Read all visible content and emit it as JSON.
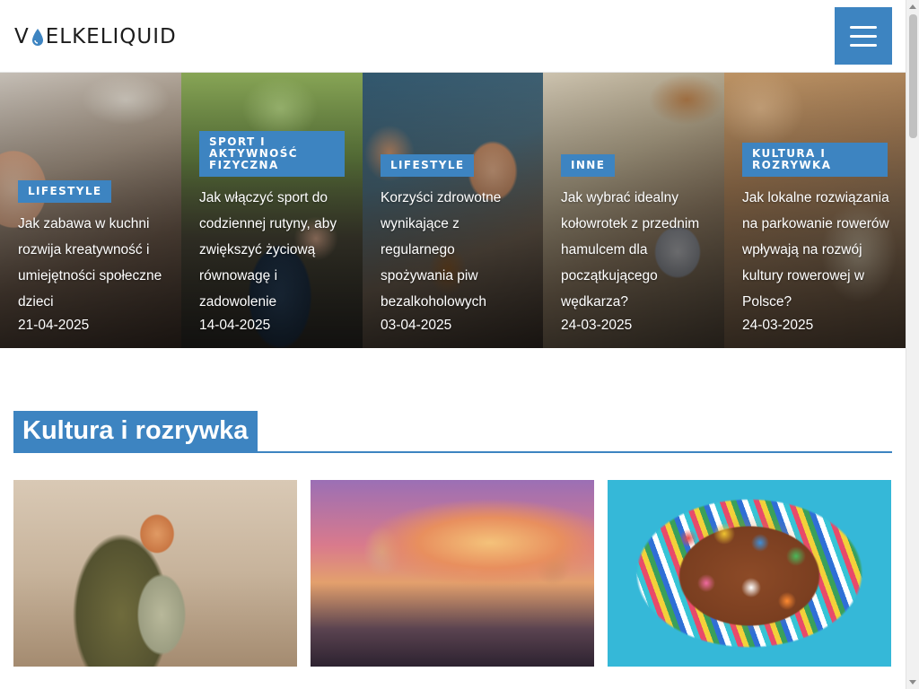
{
  "header": {
    "logo_text_left": "V",
    "logo_text_right": "ELKELIQUID",
    "logo_icon": "water-drop-icon",
    "menu_icon": "hamburger-menu-icon",
    "accent_color": "#3d84c1"
  },
  "hero": {
    "slides": [
      {
        "category": "LIFESTYLE",
        "title": "Jak zabawa w kuchni rozwija kreatywność i umiejętności społeczne dzieci",
        "date": "21-04-2025"
      },
      {
        "category": "SPORT I AKTYWNOŚĆ FIZYCZNA",
        "title": "Jak włączyć sport do codziennej rutyny, aby zwiększyć życiową równowagę i zadowolenie",
        "date": "14-04-2025"
      },
      {
        "category": "LIFESTYLE",
        "title": "Korzyści zdrowotne wynikające z regularnego spożywania piw bezalkoholowych",
        "date": "03-04-2025"
      },
      {
        "category": "INNE",
        "title": "Jak wybrać idealny kołowrotek z przednim hamulcem dla początkującego wędkarza?",
        "date": "24-03-2025"
      },
      {
        "category": "KULTURA I ROZRYWKA",
        "title": "Jak lokalne rozwiązania na parkowanie rowerów wpływają na rozwój kultury rowerowej w Polsce?",
        "date": "24-03-2025"
      }
    ]
  },
  "section": {
    "title": "Kultura i rozrywka",
    "cards": [
      {
        "title": ""
      },
      {
        "title": ""
      },
      {
        "title": ""
      }
    ]
  }
}
